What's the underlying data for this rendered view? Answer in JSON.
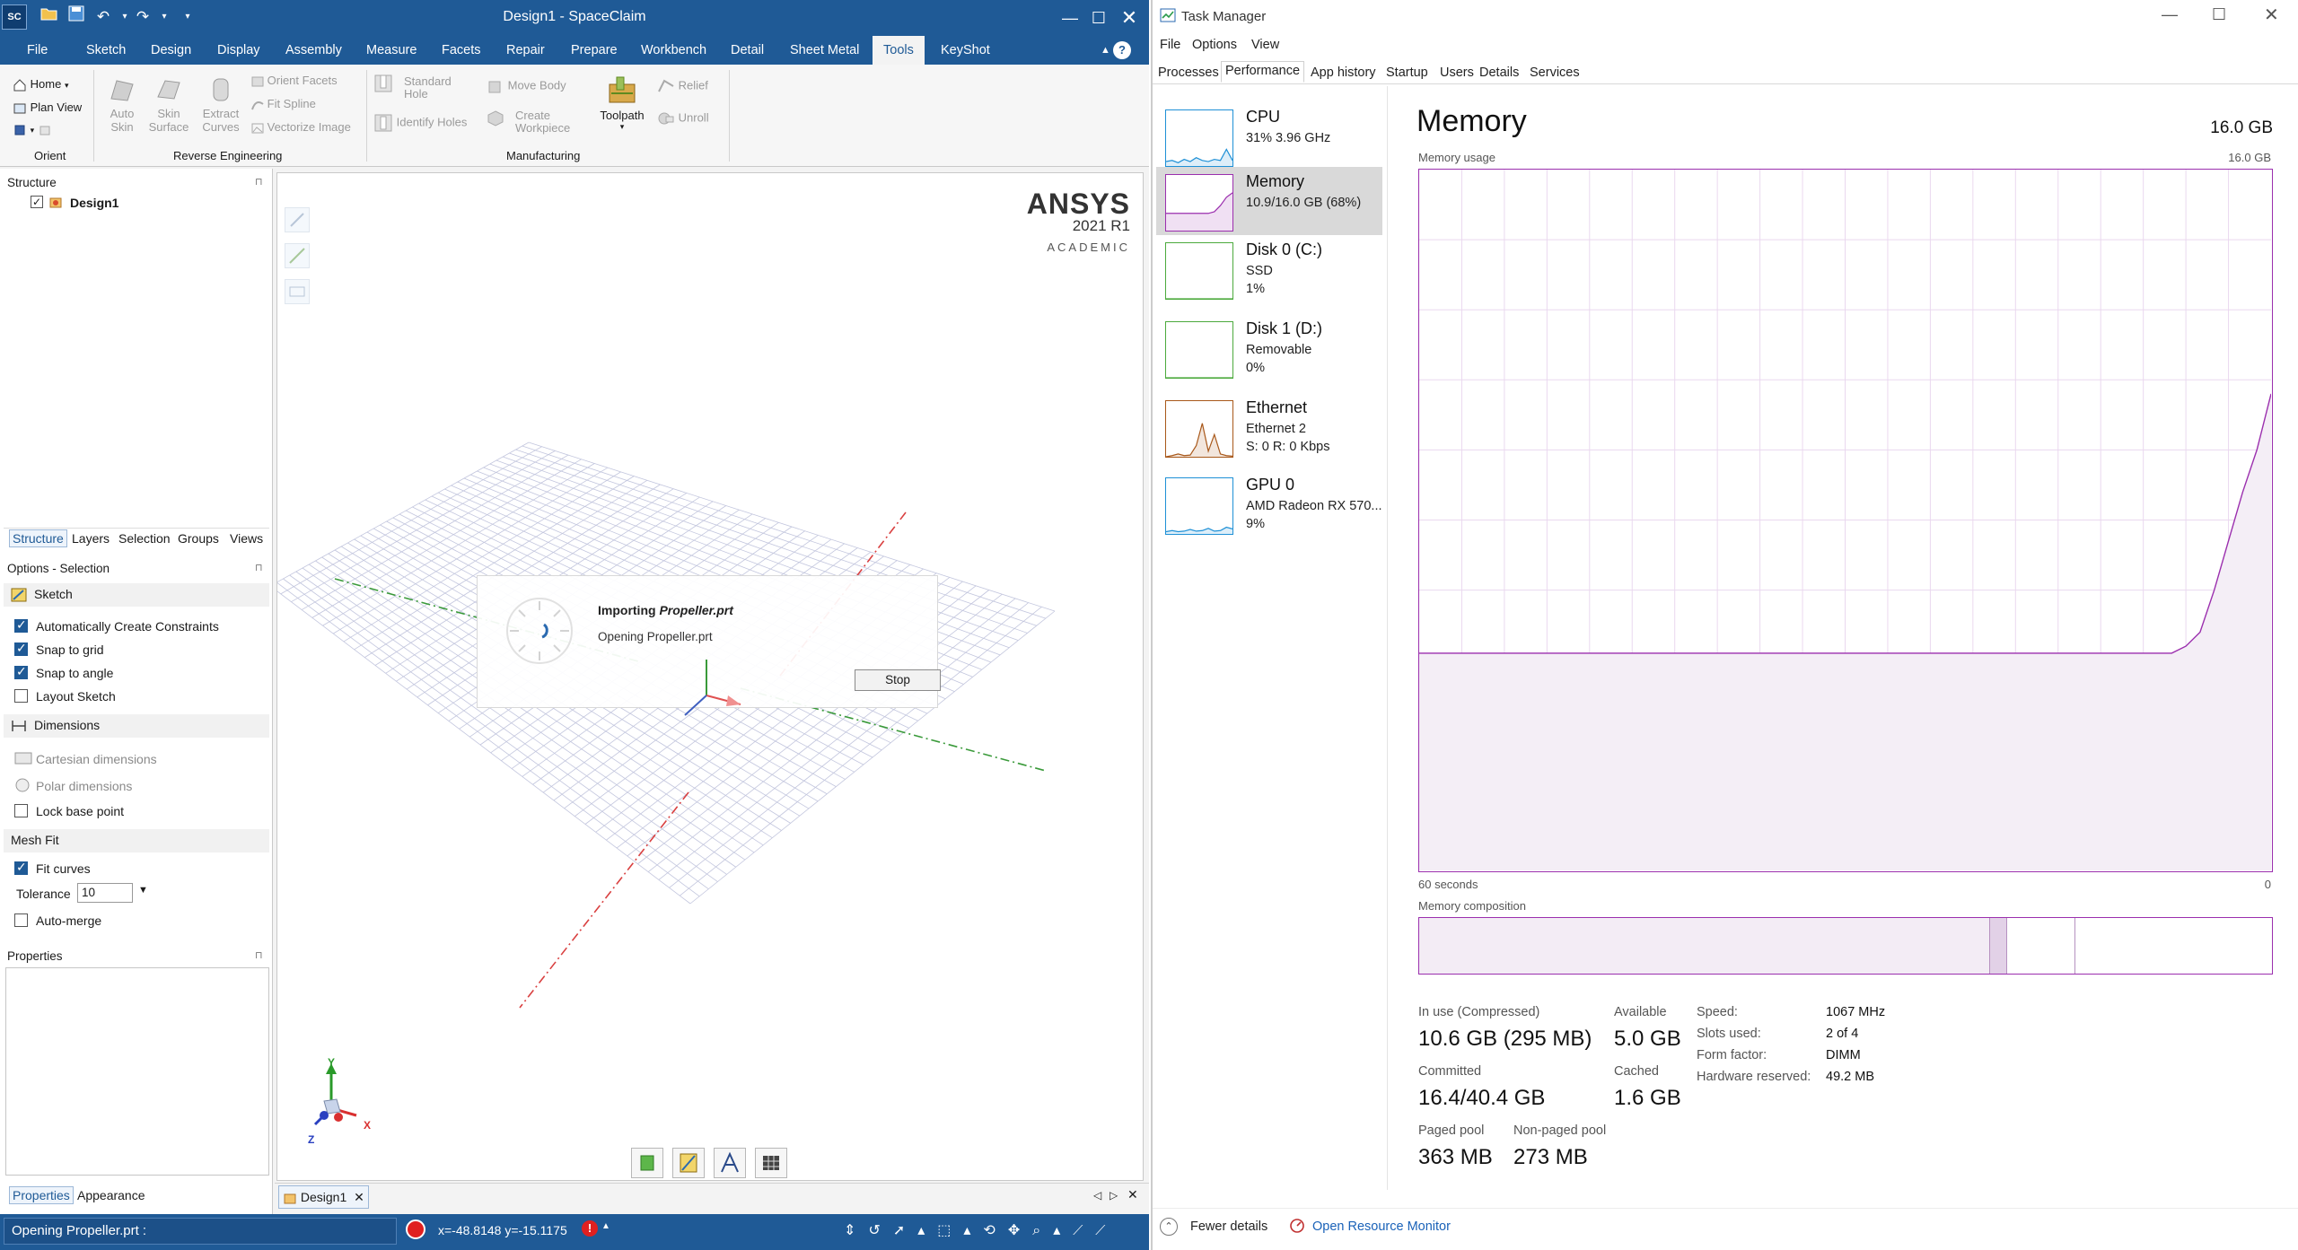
{
  "spaceclaim": {
    "title": "Design1 - SpaceClaim",
    "app_badge": "SC",
    "tabs": [
      "File",
      "Sketch",
      "Design",
      "Display",
      "Assembly",
      "Measure",
      "Facets",
      "Repair",
      "Prepare",
      "Workbench",
      "Detail",
      "Sheet Metal",
      "Tools",
      "KeyShot"
    ],
    "active_tab": "Tools",
    "ribbon": {
      "orient": {
        "home": "Home",
        "plan_view": "Plan View",
        "label": "Orient"
      },
      "reverse_engineering": {
        "auto_skin": [
          "Auto",
          "Skin"
        ],
        "skin_surface": [
          "Skin",
          "Surface"
        ],
        "extract_curves": [
          "Extract",
          "Curves"
        ],
        "orient_facets": "Orient Facets",
        "fit_spline": "Fit Spline",
        "vectorize_image": "Vectorize Image",
        "label": "Reverse Engineering"
      },
      "manufacturing": {
        "standard_hole": [
          "Standard",
          "Hole"
        ],
        "identify_holes": "Identify Holes",
        "move_body": "Move Body",
        "create_workpiece": [
          "Create",
          "Workpiece"
        ],
        "toolpath": "Toolpath",
        "relief": "Relief",
        "unroll": "Unroll",
        "label": "Manufacturing"
      }
    },
    "structure": {
      "title": "Structure",
      "root": "Design1"
    },
    "panel_tabs": [
      "Structure",
      "Layers",
      "Selection",
      "Groups",
      "Views"
    ],
    "options": {
      "title": "Options - Selection",
      "sketch_header": "Sketch",
      "sketch_items": [
        {
          "label": "Automatically Create Constraints",
          "checked": true
        },
        {
          "label": "Snap to grid",
          "checked": true
        },
        {
          "label": "Snap to angle",
          "checked": true
        },
        {
          "label": "Layout Sketch",
          "checked": false
        }
      ],
      "dimensions_header": "Dimensions",
      "cartesian": "Cartesian dimensions",
      "polar": "Polar dimensions",
      "lock_base_point": "Lock base point",
      "mesh_fit_header": "Mesh Fit",
      "fit_curves": "Fit curves",
      "tolerance_label": "Tolerance",
      "tolerance_value": "10",
      "auto_merge": "Auto-merge"
    },
    "properties_title": "Properties",
    "bottom_tabs": [
      "Properties",
      "Appearance"
    ],
    "ansys_logo": {
      "brand": "ANSYS",
      "version": "2021 R1",
      "edition": "ACADEMIC"
    },
    "import_dialog": {
      "title_prefix": "Importing ",
      "file_name": "Propeller.prt",
      "message": "Opening Propeller.prt",
      "stop_label": "Stop"
    },
    "doc_tab": "Design1",
    "status": {
      "message": "Opening Propeller.prt :",
      "coords": "x=-48.8148  y=-15.1175"
    },
    "axis_labels": {
      "x": "X",
      "y": "Y",
      "z": "Z"
    }
  },
  "task_manager": {
    "title": "Task Manager",
    "menu": [
      "File",
      "Options",
      "View"
    ],
    "tabs": [
      "Processes",
      "Performance",
      "App history",
      "Startup",
      "Users",
      "Details",
      "Services"
    ],
    "active_tab": "Performance",
    "devices": [
      {
        "name": "CPU",
        "lines": [
          "31%  3.96 GHz"
        ],
        "color": "#1e90d6",
        "selected": false
      },
      {
        "name": "Memory",
        "lines": [
          "10.9/16.0 GB (68%)"
        ],
        "color": "#9b2fae",
        "selected": true
      },
      {
        "name": "Disk 0 (C:)",
        "lines": [
          "SSD",
          "1%"
        ],
        "color": "#4caa3d",
        "selected": false
      },
      {
        "name": "Disk 1 (D:)",
        "lines": [
          "Removable",
          "0%"
        ],
        "color": "#4caa3d",
        "selected": false
      },
      {
        "name": "Ethernet",
        "lines": [
          "Ethernet 2",
          "S: 0 R: 0 Kbps"
        ],
        "color": "#a8581a",
        "selected": false
      },
      {
        "name": "GPU 0",
        "lines": [
          "AMD Radeon RX 570...",
          "9%"
        ],
        "color": "#1e90d6",
        "selected": false
      }
    ],
    "memory": {
      "title": "Memory",
      "total": "16.0 GB",
      "usage_label": "Memory usage",
      "usage_max": "16.0 GB",
      "time_left": "60 seconds",
      "time_right": "0",
      "composition_label": "Memory composition",
      "composition": {
        "in_use_fraction": 0.67,
        "modified_fraction": 0.02,
        "standby_fraction": 0.08
      },
      "usage_series": [
        0.31,
        0.31,
        0.31,
        0.31,
        0.31,
        0.31,
        0.31,
        0.31,
        0.31,
        0.31,
        0.31,
        0.31,
        0.31,
        0.31,
        0.31,
        0.31,
        0.31,
        0.31,
        0.31,
        0.31,
        0.31,
        0.31,
        0.31,
        0.31,
        0.31,
        0.31,
        0.31,
        0.31,
        0.31,
        0.31,
        0.31,
        0.31,
        0.31,
        0.31,
        0.31,
        0.31,
        0.31,
        0.31,
        0.31,
        0.31,
        0.31,
        0.31,
        0.31,
        0.31,
        0.31,
        0.31,
        0.31,
        0.31,
        0.31,
        0.31,
        0.31,
        0.31,
        0.31,
        0.31,
        0.32,
        0.34,
        0.4,
        0.47,
        0.54,
        0.6,
        0.68
      ],
      "stats": {
        "in_use_label": "In use (Compressed)",
        "in_use": "10.6 GB (295 MB)",
        "available_label": "Available",
        "available": "5.0 GB",
        "committed_label": "Committed",
        "committed": "16.4/40.4 GB",
        "cached_label": "Cached",
        "cached": "1.6 GB",
        "paged_label": "Paged pool",
        "paged": "363 MB",
        "nonpaged_label": "Non-paged pool",
        "nonpaged": "273 MB"
      },
      "details": [
        {
          "label": "Speed:",
          "value": "1067 MHz"
        },
        {
          "label": "Slots used:",
          "value": "2 of 4"
        },
        {
          "label": "Form factor:",
          "value": "DIMM"
        },
        {
          "label": "Hardware reserved:",
          "value": "49.2 MB"
        }
      ]
    },
    "footer": {
      "fewer_details": "Fewer details",
      "resource_monitor": "Open Resource Monitor"
    }
  }
}
